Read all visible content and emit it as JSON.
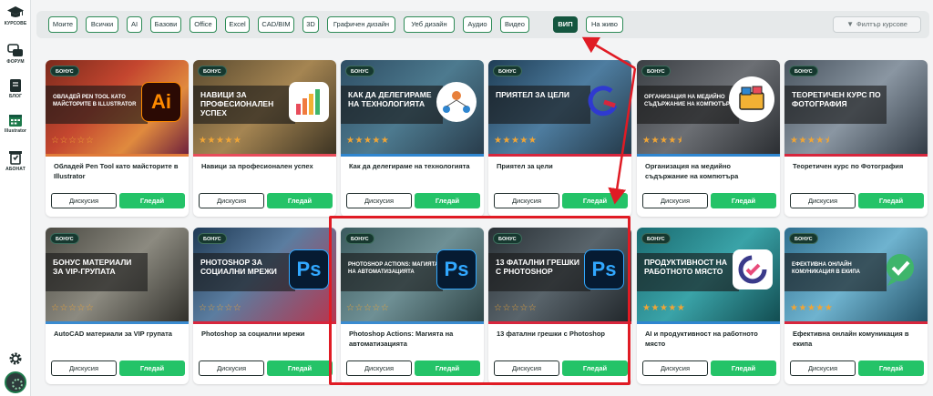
{
  "sidebar": {
    "items": [
      {
        "icon": "graduation-cap-icon",
        "label": "КУРСОВЕ"
      },
      {
        "icon": "chat-bubble-icon",
        "label": "ФОРУМ"
      },
      {
        "icon": "book-icon",
        "label": "БЛОГ"
      },
      {
        "icon": "calendar-icon",
        "label": "Illustrator"
      },
      {
        "icon": "membership-icon",
        "label": "АБОНАТ"
      }
    ],
    "settings_icon": "gear-icon",
    "avatar_icon": "avatar"
  },
  "filters": {
    "chips": [
      "Моите",
      "Всички",
      "AI",
      "Базови",
      "Office",
      "Excel",
      "CAD/BIM",
      "3D",
      "Графичен дизайн",
      "Уеб дизайн",
      "Аудио",
      "Видео",
      "ВИП",
      "На живо"
    ],
    "active": "ВИП",
    "filter_button": "Филтър курсове"
  },
  "card_common": {
    "badge": "БОНУС",
    "discuss_label": "Дискусия",
    "watch_label": "Гледай"
  },
  "cards": [
    {
      "title": "Обладей Pen Tool като майсторите в Illustrator",
      "thumb_text": "ОВЛАДЕЙ PEN TOOL КАТО МАЙСТОРИТЕ В ILLUSTRATOR",
      "rating": 0,
      "icon": "illustrator-logo-icon",
      "logo_text": "Ai"
    },
    {
      "title": "Навици за професионален успех",
      "thumb_text": "НАВИЦИ ЗА ПРОФЕСИОНАЛЕН УСПЕХ",
      "rating": 5,
      "icon": "bar-chart-icon"
    },
    {
      "title": "Как да делегираме на технологията",
      "thumb_text": "КАК ДА ДЕЛЕГИРАМЕ НА ТЕХНОЛОГИЯТА",
      "rating": 5,
      "icon": "team-network-icon"
    },
    {
      "title": "Приятел за цели",
      "thumb_text": "ПРИЯТЕЛ ЗА ЦЕЛИ",
      "rating": 5,
      "icon": "goal-logo-icon"
    },
    {
      "title": "Организация на медийно съдържание на компютъра",
      "thumb_text": "ОРГАНИЗАЦИЯ НА МЕДИЙНО СЪДЪРЖАНИЕ НА КОМПЮТЪРА",
      "rating": 4.5,
      "icon": "media-folder-icon"
    },
    {
      "title": "Теоретичен курс по Фотография",
      "thumb_text": "ТЕОРЕТИЧЕН КУРС ПО ФОТОГРАФИЯ",
      "rating": 4.5,
      "icon": "camera-icon"
    },
    {
      "title": "AutoCAD материали за VIP групата",
      "thumb_text": "БОНУС МАТЕРИАЛИ ЗА VIP-ГРУПАТА",
      "rating": 0,
      "icon": "tablet-icon"
    },
    {
      "title": "Photoshop за социални мрежи",
      "thumb_text": "PHOTOSHOP ЗА СОЦИАЛНИ МРЕЖИ",
      "rating": 0,
      "icon": "photoshop-logo-icon",
      "logo_text": "Ps"
    },
    {
      "title": "Photoshop Actions: Магията на автоматизацията",
      "thumb_text": "PHOTOSHOP ACTIONS: МАГИЯТА НА АВТОМАТИЗАЦИЯТА",
      "rating": 0,
      "icon": "photoshop-logo-icon",
      "logo_text": "Ps"
    },
    {
      "title": "13 фатални грешки с Photoshop",
      "thumb_text": "13 ФАТАЛНИ ГРЕШКИ С PHOTOSHOP",
      "rating": 0,
      "icon": "photoshop-logo-icon",
      "logo_text": "Ps"
    },
    {
      "title": "AI и продуктивност на работното място",
      "thumb_text": "ПРОДУКТИВНОСТ НА РАБОТНОТО МЯСТО",
      "rating": 5,
      "icon": "ai-logos-icon"
    },
    {
      "title": "Ефективна онлайн комуникация в екипа",
      "thumb_text": "ЕФЕКТИВНА ОНЛАЙН КОМУНИКАЦИЯ В ЕКИПА",
      "rating": 5,
      "icon": "chat-check-icon"
    }
  ],
  "colors": {
    "accent_green": "#24c368",
    "dark_green": "#14563f",
    "star": "#f0a536",
    "annotation_red": "#e01b24"
  }
}
